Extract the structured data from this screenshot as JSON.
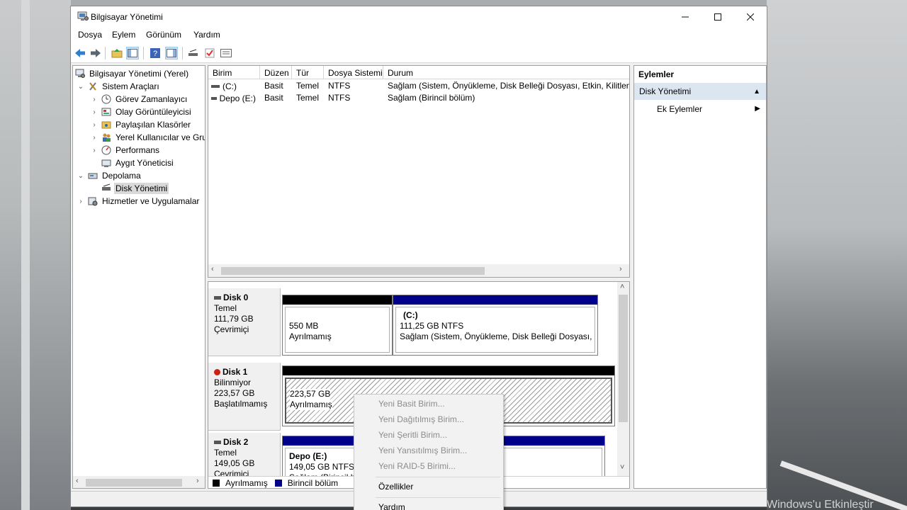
{
  "window": {
    "title": "Bilgisayar Yönetimi"
  },
  "menu": [
    "Dosya",
    "Eylem",
    "Görünüm",
    "Yardım"
  ],
  "tree": {
    "root": "Bilgisayar Yönetimi (Yerel)",
    "system_tools": "Sistem Araçları",
    "task_scheduler": "Görev Zamanlayıcı",
    "event_viewer": "Olay Görüntüleyicisi",
    "shared_folders": "Paylaşılan Klasörler",
    "local_users": "Yerel Kullanıcılar ve Gru",
    "performance": "Performans",
    "device_manager": "Aygıt Yöneticisi",
    "storage": "Depolama",
    "disk_management": "Disk Yönetimi",
    "services_apps": "Hizmetler ve Uygulamalar"
  },
  "volume_list": {
    "columns": [
      "Birim",
      "Düzen",
      "Tür",
      "Dosya Sistemi",
      "Durum"
    ],
    "rows": [
      [
        "(C:)",
        "Basit",
        "Temel",
        "NTFS",
        "Sağlam (Sistem, Önyükleme, Disk Belleği Dosyası, Etkin, Kilitlenm"
      ],
      [
        "Depo (E:)",
        "Basit",
        "Temel",
        "NTFS",
        "Sağlam (Birincil bölüm)"
      ]
    ]
  },
  "disks": [
    {
      "name": "Disk 0",
      "type": "Temel",
      "size": "111,79 GB",
      "status": "Çevrimiçi",
      "partitions": [
        {
          "title": "",
          "size": "550 MB",
          "desc": "Ayrılmamış"
        },
        {
          "title": "(C:)",
          "size": "111,25 GB NTFS",
          "desc": "Sağlam (Sistem, Önyükleme, Disk Belleği Dosyası, Et"
        }
      ]
    },
    {
      "name": "Disk 1",
      "type": "Bilinmiyor",
      "size": "223,57 GB",
      "status": "Başlatılmamış",
      "partitions": [
        {
          "title": "",
          "size": "223,57 GB",
          "desc": "Ayrılmamış"
        }
      ]
    },
    {
      "name": "Disk 2",
      "type": "Temel",
      "size": "149,05 GB",
      "status": "Çevrimiçi",
      "partitions": [
        {
          "title": "Depo  (E:)",
          "size": "149,05 GB NTFS",
          "desc": "Sağlam (Birincil b"
        }
      ]
    }
  ],
  "legend": [
    "Ayrılmamış",
    "Birincil bölüm"
  ],
  "actions": {
    "header": "Eylemler",
    "section": "Disk Yönetimi",
    "more": "Ek Eylemler"
  },
  "context_menu": [
    "Yeni Basit Birim...",
    "Yeni Dağıtılmış Birim...",
    "Yeni Şeritli Birim...",
    "Yeni Yansıtılmış Birim...",
    "Yeni RAID-5 Birimi...",
    "Özellikler",
    "Yardım"
  ],
  "watermark": "Windows'u Etkinleştir",
  "colors": {
    "unallocated": "#000000",
    "primary_partition": "#00008b",
    "selection": "#dce6f0"
  }
}
